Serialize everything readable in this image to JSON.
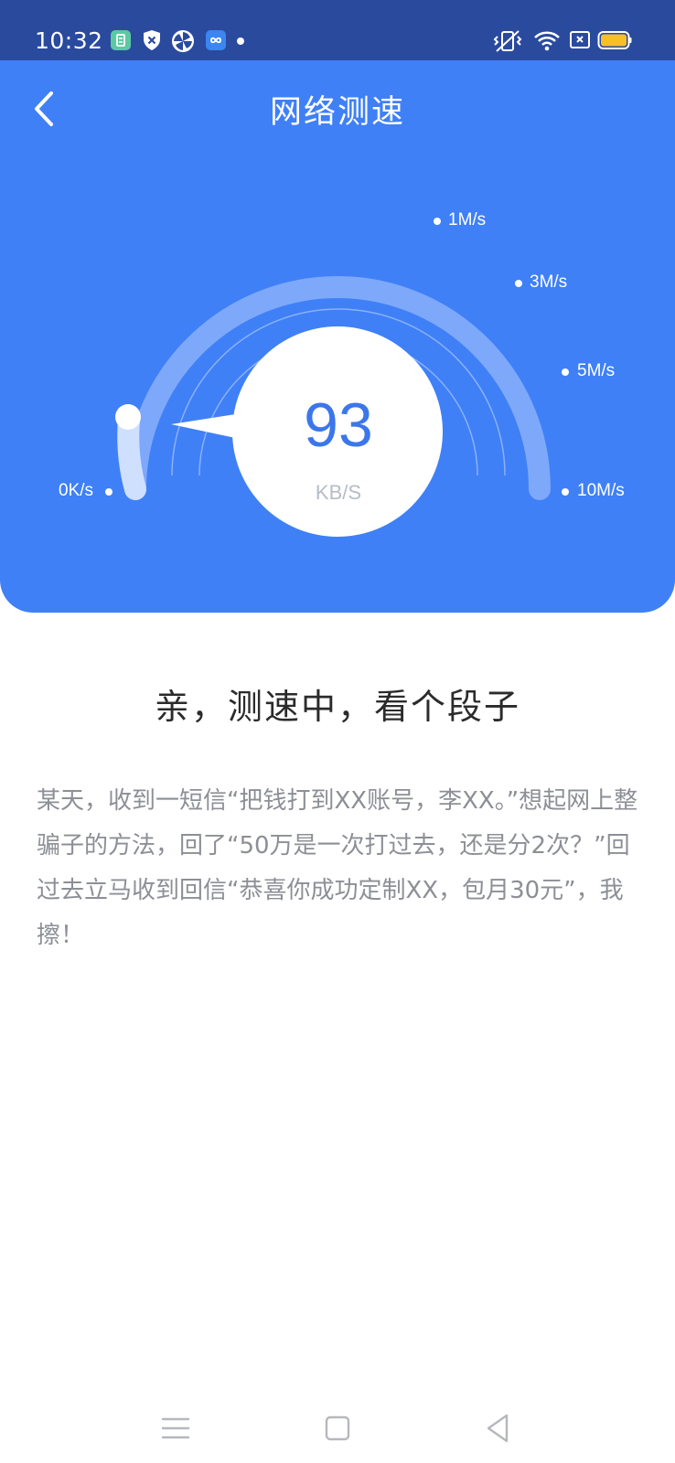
{
  "status_bar": {
    "time": "10:32",
    "icons": [
      "calculator-app-icon",
      "shield-x-icon",
      "pinwheel-icon",
      "infinity-app-icon",
      "dot-icon"
    ],
    "right_icons": [
      "vibrate-icon",
      "wifi-icon",
      "sim-x-icon",
      "battery-icon"
    ],
    "battery_color": "#f6c026"
  },
  "header": {
    "title": "网络测速",
    "back_icon": "chevron-left-icon",
    "background_color": "#3f80f7"
  },
  "speed_gauge": {
    "value": "93",
    "unit": "KB/S",
    "tick_labels": [
      "0K/s",
      "1M/s",
      "3M/s",
      "5M/s",
      "10M/s"
    ],
    "progress_fraction": 0.0
  },
  "content": {
    "heading": "亲，测速中，看个段子",
    "joke": "某天，收到一短信“把钱打到XX账号，李XX。”想起网上整骗子的方法，回了“50万是一次打过去，还是分2次？”回过去立马收到回信“恭喜你成功定制XX，包月30元”，我擦！"
  },
  "nav_bar": {
    "icons": [
      "menu-icon",
      "home-square-icon",
      "back-triangle-icon"
    ]
  }
}
